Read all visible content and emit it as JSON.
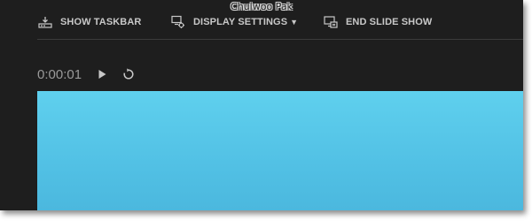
{
  "window": {
    "title": "Chulwoo Pak"
  },
  "toolbar": {
    "show_taskbar": {
      "label": "SHOW TASKBAR",
      "icon": "taskbar-icon"
    },
    "display_settings": {
      "label": "DISPLAY SETTINGS",
      "caret": "▼",
      "icon": "display-settings-icon"
    },
    "end_slide_show": {
      "label": "END SLIDE SHOW",
      "icon": "end-slideshow-icon"
    }
  },
  "controls": {
    "timer": "0:00:01",
    "play_icon": "play-icon",
    "restart_icon": "restart-icon"
  },
  "colors": {
    "background": "#1e1e1e",
    "toolbar_text": "#c8c8c8",
    "timer_text": "#9a9a9a",
    "slide_top": "#5fd0ee",
    "slide_bottom": "#4bb8de"
  }
}
